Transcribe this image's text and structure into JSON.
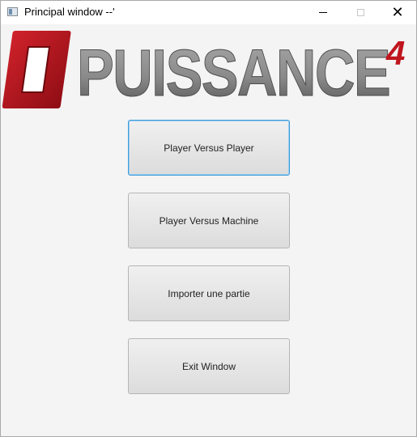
{
  "window": {
    "title": "Principal window --'",
    "icons": {
      "app": "app-window-icon",
      "minimize": "minimize-icon",
      "maximize": "maximize-icon",
      "close": "close-icon"
    },
    "close_glyph": "✕"
  },
  "logo": {
    "text_box_letter": "O",
    "text_rest": "PUISSANCE",
    "superscript": "4",
    "colors": {
      "box": "#b5121b",
      "box_dark": "#7a0a10",
      "text_top": "#9a9a9a",
      "text_bottom": "#5a5a5a",
      "four": "#b5121b"
    }
  },
  "menu": {
    "buttons": [
      {
        "label": "Player Versus Player",
        "focused": true
      },
      {
        "label": "Player Versus Machine"
      },
      {
        "label": "Importer une partie"
      },
      {
        "label": "Exit Window"
      }
    ]
  },
  "colors": {
    "focus_border": "#3a9bdb",
    "background": "#f4f4f4"
  }
}
